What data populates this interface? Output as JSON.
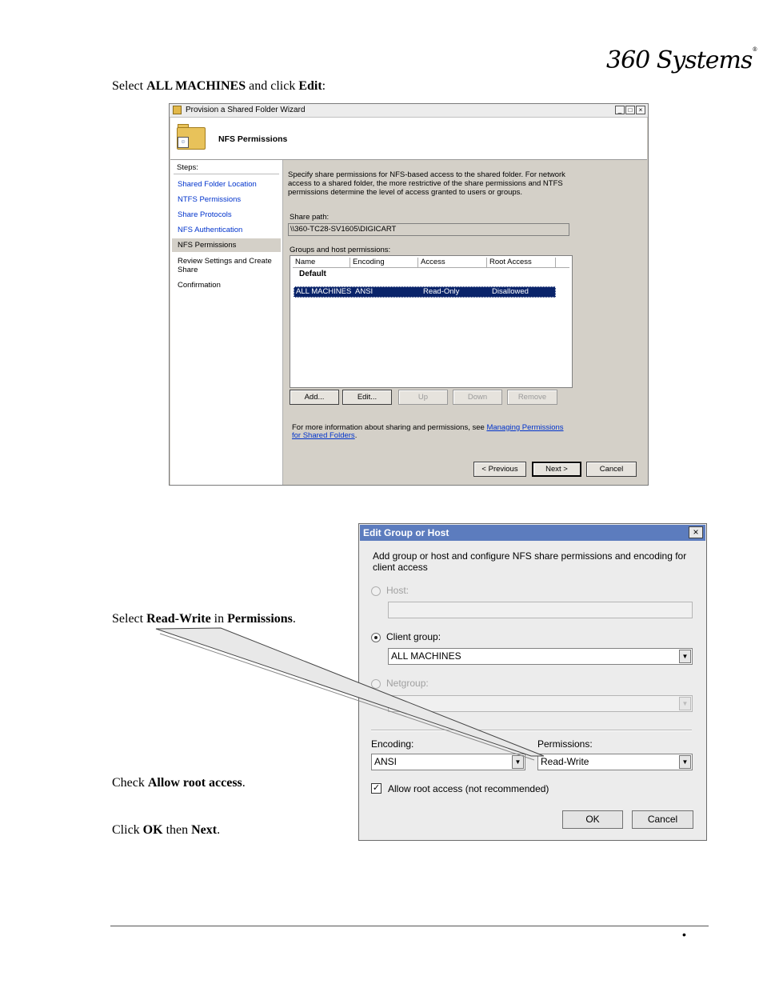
{
  "logo": {
    "text": "360 Systems",
    "mark": "®"
  },
  "instructions": {
    "step1": {
      "pre": "Select ",
      "b1": "ALL MACHINES",
      "mid": " and click ",
      "b2": "Edit",
      "post": ":"
    },
    "step2": {
      "pre": "Select ",
      "b1": "Read-Write",
      "mid": " in ",
      "b2": "Permissions",
      "post": "."
    },
    "step3": {
      "pre": "Check ",
      "b1": "Allow root access",
      "post": "."
    },
    "step4": {
      "pre": "Click ",
      "b1": "OK",
      "mid": " then ",
      "b2": "Next",
      "post": "."
    }
  },
  "wizard": {
    "title": "Provision a Shared Folder Wizard",
    "window_buttons": {
      "minimize": "_",
      "maximize": "□",
      "close": "×"
    },
    "header_title": "NFS Permissions",
    "steps_label": "Steps:",
    "steps": [
      {
        "label": "Shared Folder Location",
        "state": "link"
      },
      {
        "label": "NTFS Permissions",
        "state": "link"
      },
      {
        "label": "Share Protocols",
        "state": "link"
      },
      {
        "label": "NFS Authentication",
        "state": "link"
      },
      {
        "label": "NFS Permissions",
        "state": "current"
      },
      {
        "label": "Review Settings and Create Share",
        "state": "plain"
      },
      {
        "label": "Confirmation",
        "state": "plain"
      }
    ],
    "description": "Specify share permissions for NFS-based access to the shared folder. For network access to a shared folder, the more restrictive of the share permissions and NTFS permissions determine the level of access granted to users or groups.",
    "share_path_label": "Share path:",
    "share_path": "\\\\360-TC28-SV1605\\DIGICART",
    "groups_label": "Groups and host permissions:",
    "columns": [
      "Name",
      "Encoding",
      "Access",
      "Root Access"
    ],
    "group_header": "Default",
    "rows": [
      {
        "name": "ALL MACHINES",
        "encoding": "ANSI",
        "access": "Read-Only",
        "root_access": "Disallowed"
      }
    ],
    "buttons": {
      "add": "Add...",
      "edit": "Edit...",
      "up": "Up",
      "down": "Down",
      "remove": "Remove"
    },
    "more_info_prefix": "For more information about sharing and permissions, see ",
    "more_info_link": "Managing Permissions for Shared Folders",
    "more_info_suffix": ".",
    "nav": {
      "previous": "< Previous",
      "next": "Next >",
      "cancel": "Cancel"
    }
  },
  "dialog": {
    "title": "Edit Group or Host",
    "close": "×",
    "description": "Add group or host and configure NFS share permissions and encoding for client access",
    "host_label": "Host:",
    "host_value": "",
    "client_group_label": "Client group:",
    "client_group_value": "ALL MACHINES",
    "netgroup_label": "Netgroup:",
    "netgroup_value": "",
    "encoding_label": "Encoding:",
    "encoding_value": "ANSI",
    "permissions_label": "Permissions:",
    "permissions_value": "Read-Write",
    "allow_root_label": "Allow root access (not recommended)",
    "allow_root_checked": true,
    "ok": "OK",
    "cancel": "Cancel"
  },
  "footer": {
    "bullet": "•"
  },
  "colors": {
    "title_bar": "#5c7cbe",
    "selection": "#0a246a",
    "link": "#0033cc",
    "wizard_bg": "#d4d0c8"
  },
  "icons": [
    "folder-users-icon",
    "radio-icon",
    "checkbox-icon",
    "dropdown-arrow-icon",
    "close-icon"
  ]
}
